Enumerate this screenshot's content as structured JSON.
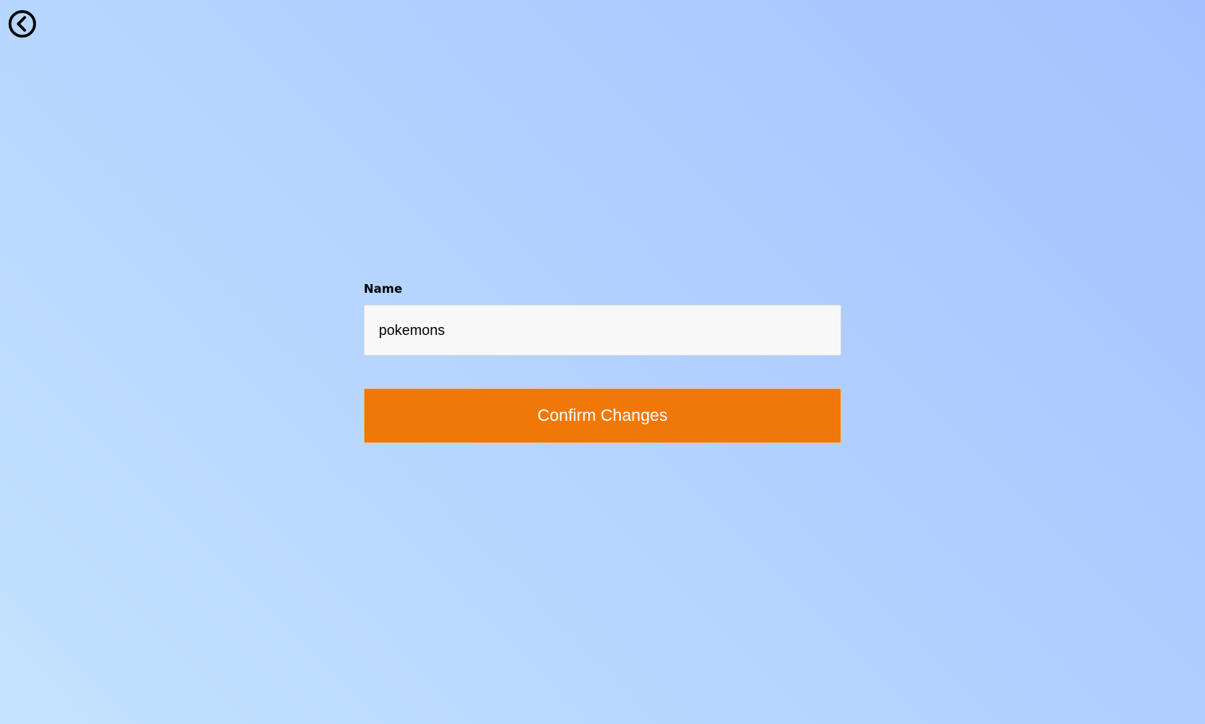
{
  "colors": {
    "background_start": "#c3e3ff",
    "background_end": "#a4c2ff",
    "accent": "#f07809",
    "input_bg": "#f8f8f8"
  },
  "back": {
    "icon": "chevron-left-circle-icon"
  },
  "form": {
    "name_label": "Name",
    "name_value": "pokemons",
    "confirm_label": "Confirm Changes"
  }
}
